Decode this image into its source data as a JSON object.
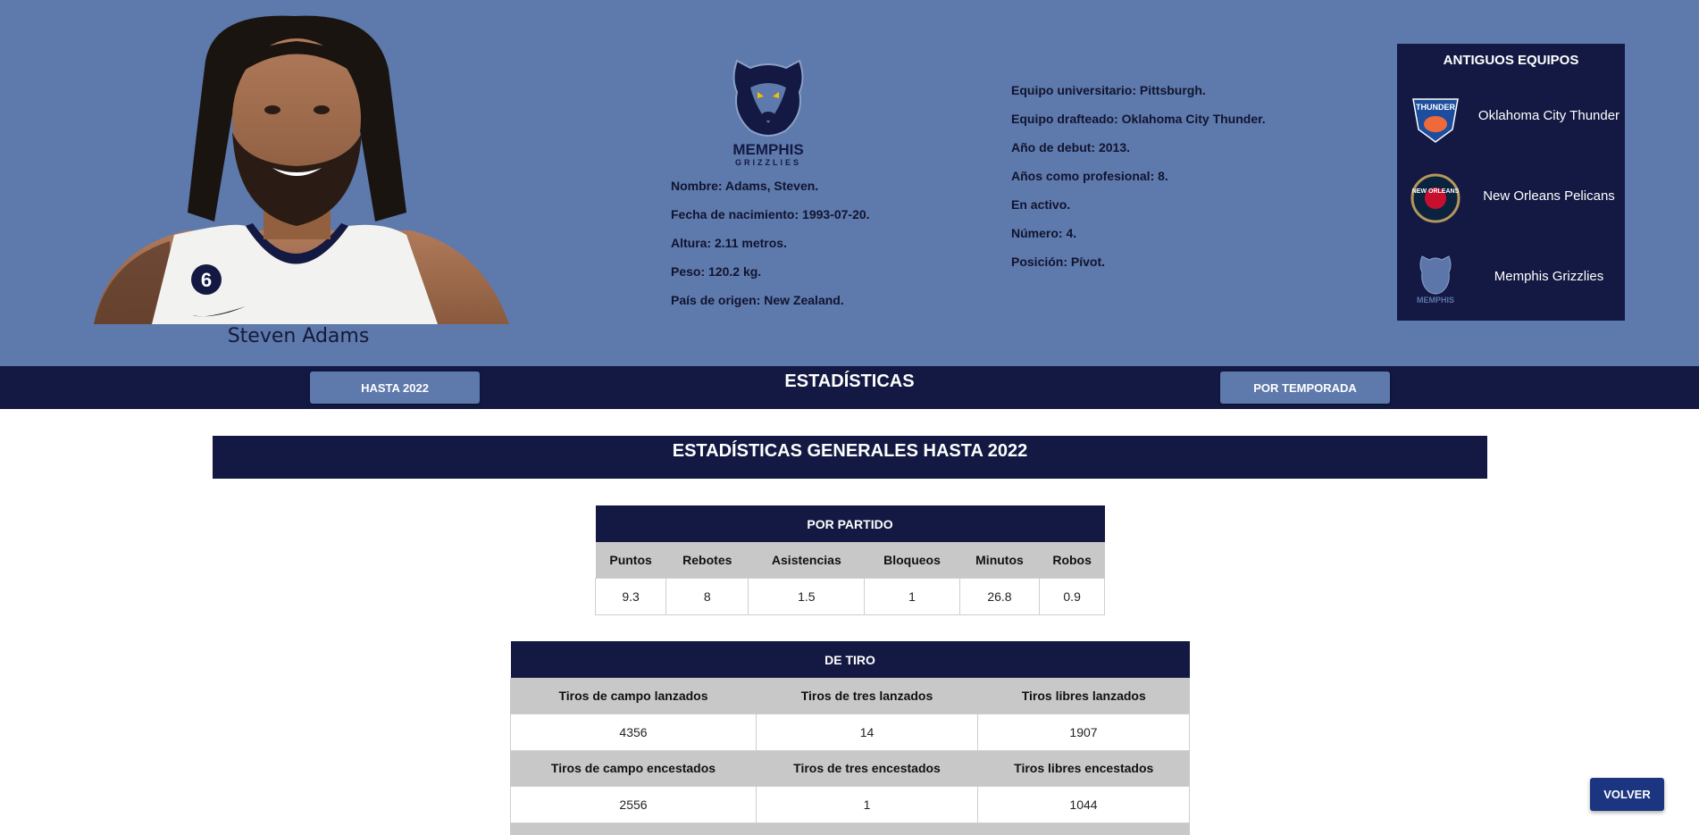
{
  "player": {
    "name": "Steven Adams",
    "jersey_number": "6",
    "info_left": [
      "Nombre: Adams, Steven.",
      "Fecha de nacimiento: 1993-07-20.",
      "Altura: 2.11 metros.",
      "Peso: 120.2 kg.",
      "País de origen: New Zealand."
    ],
    "info_right": [
      "Equipo universitario: Pittsburgh.",
      "Equipo drafteado: Oklahoma City Thunder.",
      "Año de debut: 2013.",
      "Años como profesional: 8.",
      "En activo.",
      "Número: 4.",
      "Posición: Pívot."
    ]
  },
  "team_logo": {
    "line1": "MEMPHIS",
    "line2": "GRIZZLIES",
    "icon": "grizzlies-logo"
  },
  "former_teams": {
    "title": "ANTIGUOS EQUIPOS",
    "teams": [
      {
        "name": "Oklahoma City Thunder",
        "icon": "okc-thunder-logo",
        "logo_text": "THUNDER"
      },
      {
        "name": "New Orleans Pelicans",
        "icon": "pelicans-logo",
        "logo_text": "NEW ORLEANS"
      },
      {
        "name": "Memphis Grizzlies",
        "icon": "grizzlies-logo",
        "logo_text": "MEMPHIS"
      }
    ]
  },
  "nav": {
    "left_button": "HASTA 2022",
    "title": "ESTADÍSTICAS",
    "right_button": "POR TEMPORADA"
  },
  "section_title": "ESTADÍSTICAS GENERALES HASTA 2022",
  "per_game": {
    "caption": "POR PARTIDO",
    "headers": [
      "Puntos",
      "Rebotes",
      "Asistencias",
      "Bloqueos",
      "Minutos",
      "Robos"
    ],
    "values": [
      "9.3",
      "8",
      "1.5",
      "1",
      "26.8",
      "0.9"
    ]
  },
  "shooting": {
    "caption": "DE TIRO",
    "headers_1": [
      "Tiros de campo lanzados",
      "Tiros de tres lanzados",
      "Tiros libres lanzados"
    ],
    "values_1": [
      "4356",
      "14",
      "1907"
    ],
    "headers_2": [
      "Tiros de campo encestados",
      "Tiros de tres encestados",
      "Tiros libres encestados"
    ],
    "values_2": [
      "2556",
      "1",
      "1044"
    ]
  },
  "back_button": "VOLVER",
  "colors": {
    "header_bg": "#5e79ab",
    "navy": "#131942",
    "table_header_gray": "#c8c8c8",
    "back_button": "#1c3580"
  }
}
